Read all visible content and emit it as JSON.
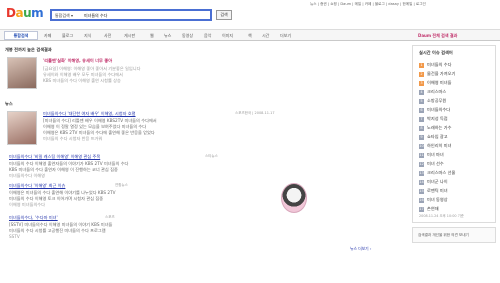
{
  "header": {
    "logo": "Daum",
    "search_scope": "통합검색",
    "search_value": "미녀들의 수다",
    "search_button": "검색",
    "top_links": [
      "뉴스",
      "증권",
      "쇼핑",
      "Daum",
      "메일",
      "카페",
      "블로그",
      "dasay",
      "한메일",
      "로그인"
    ]
  },
  "tabs": [
    "통합검색",
    "카페",
    "블로그",
    "지식",
    "사전",
    "게시판",
    "웹",
    "뉴스",
    "동영상",
    "음악",
    "이미지",
    "책",
    "시간",
    "더보기"
  ],
  "tab_right": "Daum 전체 검색 결과",
  "sections": {
    "related_title": "개봉 전까지 높은 검색결과",
    "related_item": {
      "title": "'리틀맨'실화' 이해영, 유세이 너무 좋아",
      "lines": [
        "[금요일] 이해영: 이해영 좋아 좋아서 기분좋은 일입니다",
        "유세이와 이해영 배우 모두 미녀들의 수다에서",
        "KBS 미녀들의 수다 이해영 출연 시청률 상승"
      ]
    },
    "news_title": "뉴스",
    "news": [
      {
        "title": "미녀들의수다 '대단한 여자 배우' 이해영, 시청자 호평",
        "date": "스포츠한국 | 2008.11.17",
        "lines": [
          "[미녀들의 수다] 리틀맨 배우 이해영 KBS2TV 미녀들의 수다에서",
          "이해영 이 정말 열정 있는 모습을 보여주었다 미녀들의 수다",
          "이해영은 KBS 2TV 미녀들의 수다에 출연해 좋은 반응을 얻었다",
          "미녀들의 수다 시청자 반응 뜨거워"
        ]
      },
      {
        "title": "미녀들의수다 '비밀 캐스팅 이해영' 이해영 관심 주목",
        "date": "스타뉴스",
        "lines": [
          "미녀들의 수다 이해영 출연자들의 이야기가 KBS 2TV 미녀들의 수다",
          "KBS 미녀들의 수다 출연자 이해영 이 진행하는 코너 관심 집중",
          "미녀들의수다 이해영"
        ]
      },
      {
        "title": "미녀들의수다 '이해영' 최근 이슈",
        "date": "연합뉴스",
        "lines": [
          "이해영은 미녀들의 수다 출연해 이야기를 나누었다 KBS 2TV",
          "미녀들의 수다 이해영 토크 이어가며 시청자 관심 집중",
          "이해영 미녀들의수다"
        ]
      },
      {
        "title": "미녀들의수다, '수다마 미녀'",
        "date": "스포츠",
        "lines": [
          "[SSTV] 미녀들의수다 이해영 미녀들의 이야기 KBS 미녀들",
          "미녀들의 수다 시청률 고공행진 미녀들의 수다 프로그램",
          "SSTV"
        ]
      }
    ],
    "more_news": "뉴스 더보기 ›"
  },
  "right": {
    "rank_title": "실시간 이슈 검색어",
    "rank_items": [
      "미녀들의 수다",
      "물건을 가져오기",
      "이해영 미녀들",
      "크리스마스",
      "소방공무원",
      "미녀들의수다",
      "박지성 득점",
      "노래하는 가수",
      "쇼타임 광고",
      "하인리히 미녀",
      "미녀 마녀",
      "미녀 선수",
      "크리스마스 선물",
      "미녀군 나이",
      "로맨틱 미녀",
      "미녀 동영상",
      "손연재"
    ],
    "rank_time": "2008.11.24 오후 10:00 기준",
    "ad_text": "검색결과 개선을 위한 의견 보내기"
  }
}
